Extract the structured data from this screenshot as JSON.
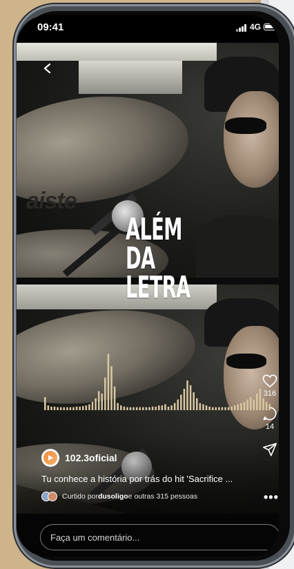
{
  "status_bar": {
    "time": "09:41",
    "network": "4G"
  },
  "overlay_title": {
    "line1": "ALÉM",
    "line2": "DA",
    "line3": "LETRA"
  },
  "brand_mark": "aiste",
  "actions": {
    "likes_count": "316",
    "comments_count": "14"
  },
  "post": {
    "username": "102.3oficial",
    "caption": "Tu conhece a história por trás do hit 'Sacrifice ...",
    "liked_prefix": "Curtido por ",
    "liked_user": "dusoligo",
    "liked_suffix": " e outras 315 pessoas"
  },
  "comment": {
    "placeholder": "Faça um comentário..."
  },
  "icons": [
    "back-chevron-icon",
    "signal-icon",
    "battery-icon",
    "heart-icon",
    "comment-icon",
    "send-icon",
    "more-icon"
  ],
  "colors": {
    "wave": "#d9c8a2",
    "background": "#cdb48b",
    "side_panel": "#eef0f2"
  },
  "wave_levels": [
    0.22,
    0.08,
    0.06,
    0.06,
    0.05,
    0.05,
    0.05,
    0.05,
    0.05,
    0.05,
    0.06,
    0.06,
    0.07,
    0.08,
    0.1,
    0.14,
    0.2,
    0.32,
    0.28,
    0.55,
    0.95,
    0.74,
    0.4,
    0.12,
    0.08,
    0.06,
    0.05,
    0.05,
    0.05,
    0.05,
    0.05,
    0.05,
    0.05,
    0.05,
    0.06,
    0.06,
    0.08,
    0.08,
    0.1,
    0.06,
    0.08,
    0.12,
    0.18,
    0.26,
    0.36,
    0.5,
    0.42,
    0.3,
    0.2,
    0.12,
    0.1,
    0.08,
    0.06,
    0.05,
    0.05,
    0.05,
    0.05,
    0.05,
    0.05,
    0.06,
    0.08,
    0.1,
    0.12,
    0.14,
    0.18,
    0.22,
    0.18,
    0.28,
    0.36,
    0.2,
    0.14,
    0.1
  ]
}
